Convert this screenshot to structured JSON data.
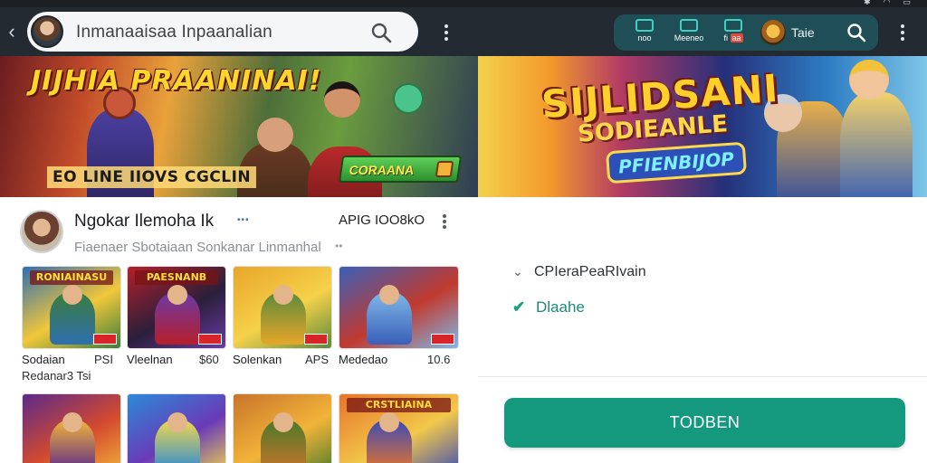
{
  "status_bar": {
    "icons": [
      "settings-icon",
      "wifi-icon",
      "battery-icon"
    ]
  },
  "topbar": {
    "search_text": "Inmanaaisaa Inpaanalian",
    "right_panel": {
      "items": [
        {
          "label": "noo"
        },
        {
          "label": "Meeneo"
        },
        {
          "label": "fi",
          "badge": "aa"
        }
      ],
      "name": "Taie"
    }
  },
  "banners": {
    "left": {
      "title": "JIJHIA PRAANINAI!",
      "caption": "EO LINE IIOVS CGCLIN",
      "cta": "CORAANA"
    },
    "right": {
      "title": "SIJLIDSANI",
      "subtitle": "SODIEANLE",
      "tag": "PFIENBIJOP"
    }
  },
  "profile": {
    "name": "Ngokar Ilemoha Ik",
    "dots": "•••",
    "meta": "APIG IOO8kO",
    "subtitle": "Fiaenaer Sbotaiaan Sonkanar Linmanhal",
    "sub_dots": "••"
  },
  "tiles": [
    {
      "banner": "RONIAINASU",
      "name": "Sodaian",
      "value": "PSI",
      "sub": "Redanar3 Tsi",
      "colors": [
        "#2f6fb0",
        "#f2c73a",
        "#3a7d3a"
      ]
    },
    {
      "banner": "PAESNANB",
      "name": "Vleelnan",
      "value": "$60",
      "sub": "",
      "colors": [
        "#b61f2a",
        "#2a1f3a",
        "#6a3aa8"
      ]
    },
    {
      "banner": "",
      "name": "Solenkan",
      "value": "APS",
      "sub": "",
      "colors": [
        "#e8a62a",
        "#f6d14a",
        "#5a8a3a"
      ]
    },
    {
      "banner": "",
      "name": "Mededao",
      "value": "10.6",
      "sub": "",
      "colors": [
        "#3a5fb8",
        "#c13a2e",
        "#7fb8e8"
      ]
    },
    {
      "banner": "",
      "name": "",
      "value": "",
      "sub": "",
      "colors": [
        "#5b2a8a",
        "#d44a2e",
        "#f2b43a"
      ]
    },
    {
      "banner": "",
      "name": "",
      "value": "",
      "sub": "",
      "colors": [
        "#2a8ad8",
        "#6a3ab8",
        "#f2d84a"
      ]
    },
    {
      "banner": "",
      "name": "",
      "value": "",
      "sub": "",
      "colors": [
        "#c8742a",
        "#f2b43a",
        "#4a7a2a"
      ]
    },
    {
      "banner": "CRSTLIAINA",
      "name": "",
      "value": "",
      "sub": "",
      "colors": [
        "#e8742a",
        "#f2c84a",
        "#3a4ab8"
      ]
    }
  ],
  "details": {
    "row1": "CPIeraPeaRIvain",
    "row2": "Dlaahe",
    "button": "TODBEN"
  },
  "colors": {
    "accent": "#14997f",
    "topbar": "#232a31",
    "panel": "#1f4e57"
  }
}
